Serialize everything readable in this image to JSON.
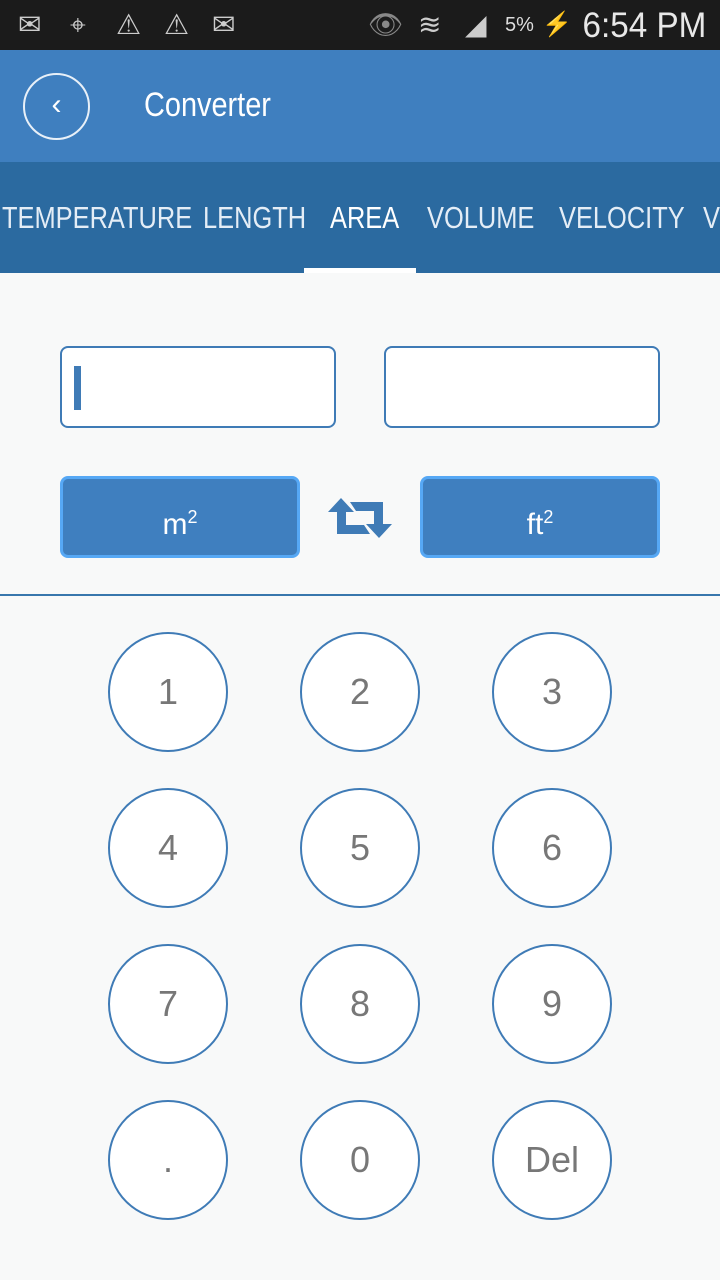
{
  "status_bar": {
    "time": "6:54 PM",
    "battery": "5%",
    "icons": [
      "mail-icon",
      "gps-icon",
      "warning-icon",
      "warning-icon",
      "email-icon",
      "eye-icon",
      "wifi-icon",
      "signal-icon",
      "battery-charging-icon"
    ]
  },
  "header": {
    "title": "Converter",
    "back_icon": "chevron-left-icon"
  },
  "tabs": [
    {
      "label": "TEMPERATURE"
    },
    {
      "label": "LENGTH"
    },
    {
      "label": "AREA",
      "active": true
    },
    {
      "label": "VOLUME"
    },
    {
      "label": "VELOCITY"
    },
    {
      "label": "VO"
    }
  ],
  "converter": {
    "input_value": "",
    "output_value": "",
    "from_unit": "m",
    "from_unit_exp": "2",
    "to_unit": "ft",
    "to_unit_exp": "2",
    "swap_icon": "swap-arrows-icon"
  },
  "keypad": [
    "1",
    "2",
    "3",
    "4",
    "5",
    "6",
    "7",
    "8",
    "9",
    ".",
    "0",
    "Del"
  ],
  "colors": {
    "header": "#3f7fbf",
    "tabs": "#2b6aa0",
    "accent": "#3f7bb6",
    "status_bar": "#1b1b1b"
  }
}
